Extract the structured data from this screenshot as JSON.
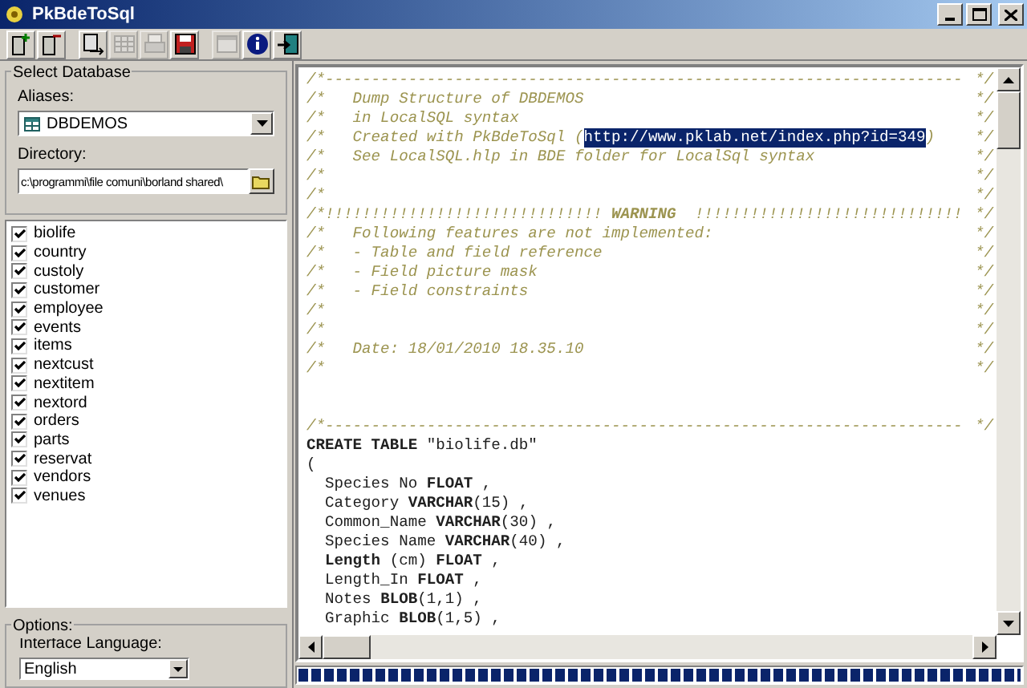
{
  "window": {
    "title": "PkBdeToSql"
  },
  "toolbar": [
    {
      "kind": "db-add",
      "disabled": false
    },
    {
      "kind": "db-remove",
      "disabled": false
    },
    {
      "kind": "export",
      "disabled": false
    },
    {
      "kind": "grid",
      "disabled": true
    },
    {
      "kind": "print",
      "disabled": true
    },
    {
      "kind": "save",
      "disabled": false
    },
    {
      "kind": "window",
      "disabled": true
    },
    {
      "kind": "info",
      "disabled": false
    },
    {
      "kind": "exit",
      "disabled": false
    }
  ],
  "select_database": {
    "title": "Select Database",
    "aliases_label": "Aliases:",
    "alias": "DBDEMOS",
    "directory_label": "Directory:",
    "directory": "c:\\programmi\\file comuni\\borland shared\\"
  },
  "tables": [
    {
      "label": "biolife",
      "checked": true
    },
    {
      "label": "country",
      "checked": true
    },
    {
      "label": "custoly",
      "checked": true
    },
    {
      "label": "customer",
      "checked": true
    },
    {
      "label": "employee",
      "checked": true
    },
    {
      "label": "events",
      "checked": true
    },
    {
      "label": "items",
      "checked": true
    },
    {
      "label": "nextcust",
      "checked": true
    },
    {
      "label": "nextitem",
      "checked": true
    },
    {
      "label": "nextord",
      "checked": true
    },
    {
      "label": "orders",
      "checked": true
    },
    {
      "label": "parts",
      "checked": true
    },
    {
      "label": "reservat",
      "checked": true
    },
    {
      "label": "vendors",
      "checked": true
    },
    {
      "label": "venues",
      "checked": true
    }
  ],
  "options": {
    "title": "Options:",
    "language_label": "Interface Language:",
    "language": "English"
  },
  "editor": {
    "lines": [
      {
        "kind": "comment",
        "text": "/*---------------------------------------------------------------------",
        "end": "*/"
      },
      {
        "kind": "comment",
        "text": "/*   Dump Structure of DBDEMOS",
        "end": "*/"
      },
      {
        "kind": "comment",
        "text": "/*   in LocalSQL syntax",
        "end": "*/"
      },
      {
        "kind": "comment",
        "text": "/*   Created with PkBdeToSql (",
        "selected": "http://www.pklab.net/index.php?id=349",
        "after": ")",
        "end": "*/"
      },
      {
        "kind": "comment",
        "text": "/*   See LocalSQL.hlp in BDE folder for LocalSql syntax",
        "end": "*/"
      },
      {
        "kind": "comment",
        "text": "/*",
        "end": "*/"
      },
      {
        "kind": "comment",
        "text": "/*",
        "end": "*/"
      },
      {
        "kind": "comment",
        "text": "/*!!!!!!!!!!!!!!!!!!!!!!!!!!!!!! **WARNING**  !!!!!!!!!!!!!!!!!!!!!!!!!!!!!",
        "end": "*/"
      },
      {
        "kind": "comment",
        "text": "/*   Following features are not implemented:",
        "end": "*/"
      },
      {
        "kind": "comment",
        "text": "/*   - Table and field reference",
        "end": "*/"
      },
      {
        "kind": "comment",
        "text": "/*   - Field picture mask",
        "end": "*/"
      },
      {
        "kind": "comment",
        "text": "/*   - Field constraints",
        "end": "*/"
      },
      {
        "kind": "comment",
        "text": "/*",
        "end": "*/"
      },
      {
        "kind": "comment",
        "text": "/*",
        "end": "*/"
      },
      {
        "kind": "comment",
        "text": "/*   Date: 18/01/2010 18.35.10",
        "end": "*/"
      },
      {
        "kind": "comment",
        "text": "/*",
        "end": "*/"
      },
      {
        "kind": "blank"
      },
      {
        "kind": "blank"
      },
      {
        "kind": "comment",
        "text": "/*---------------------------------------------------------------------",
        "end": "*/"
      },
      {
        "kind": "code",
        "text": "**CREATE TABLE** \"biolife.db\""
      },
      {
        "kind": "code",
        "text": "("
      },
      {
        "kind": "code",
        "text": "  Species No **FLOAT** ,"
      },
      {
        "kind": "code",
        "text": "  Category **VARCHAR**(15) ,"
      },
      {
        "kind": "code",
        "text": "  Common_Name **VARCHAR**(30) ,"
      },
      {
        "kind": "code",
        "text": "  Species Name **VARCHAR**(40) ,"
      },
      {
        "kind": "code",
        "text": "  **Length** (cm) **FLOAT** ,"
      },
      {
        "kind": "code",
        "text": "  Length_In **FLOAT** ,"
      },
      {
        "kind": "code",
        "text": "  Notes **BLOB**(1,1) ,"
      },
      {
        "kind": "code",
        "text": "  Graphic **BLOB**(1,5) ,"
      }
    ]
  },
  "progress": {
    "level": 1
  }
}
